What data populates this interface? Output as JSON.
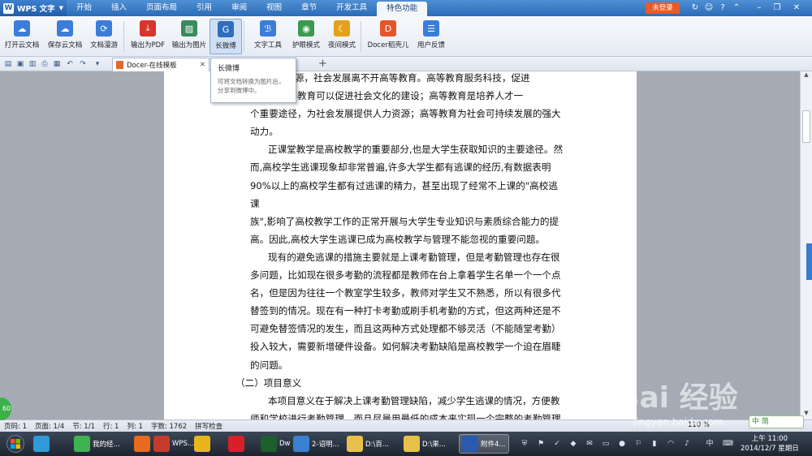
{
  "app": {
    "name": "WPS 文字"
  },
  "menu": {
    "tabs": [
      "开始",
      "插入",
      "页面布局",
      "引用",
      "审阅",
      "视图",
      "章节",
      "开发工具",
      "特色功能"
    ],
    "active_index": 8,
    "login_label": "未登录"
  },
  "ribbon": {
    "buttons": [
      {
        "label": "打开云文档",
        "icon": "cloud-open-icon",
        "color": "#3b7dd8"
      },
      {
        "label": "保存云文档",
        "icon": "cloud-save-icon",
        "color": "#3b7dd8"
      },
      {
        "label": "文档漫游",
        "icon": "roaming-icon",
        "color": "#3b7dd8"
      },
      {
        "label": "输出为PDF",
        "icon": "pdf-icon",
        "color": "#d9342b"
      },
      {
        "label": "输出为图片",
        "icon": "image-icon",
        "color": "#3a8a5c"
      },
      {
        "label": "长微博",
        "icon": "weibo-icon",
        "color": "#2f6dbf"
      },
      {
        "label": "文字工具",
        "icon": "text-tool-icon",
        "color": "#3b7dd8"
      },
      {
        "label": "护眼模式",
        "icon": "eye-icon",
        "color": "#3b9a4e"
      },
      {
        "label": "夜间模式",
        "icon": "moon-icon",
        "color": "#e4a21a"
      },
      {
        "label": "Docer稻壳儿",
        "icon": "docer-icon",
        "color": "#e8542a"
      },
      {
        "label": "用户反馈",
        "icon": "feedback-icon",
        "color": "#3b7dd8"
      }
    ]
  },
  "doc_tab": {
    "title": "Docer-在线模板"
  },
  "tooltip": {
    "title": "长微博",
    "description": "可将文档转换为图片后，分享到微博中。"
  },
  "document": {
    "lines": [
      "动力之源，社会发展离不开高等教育。高等教育服务科技，促进",
      "发展；高等教育可以促进社会文化的建设；高等教育是培养人才一",
      "个重要途径，为社会发展提供人力资源；高等教育为社会可持续发展的强大",
      "动力。",
      "正课堂教学是高校教学的重要部分,也是大学生获取知识的主要途径。然",
      "而,高校学生逃课现象却非常普遍,许多大学生都有逃课的经历,有数据表明",
      "90%以上的高校学生都有过逃课的精力，甚至出现了经常不上课的\"高校逃课",
      "族\",影响了高校教学工作的正常开展与大学生专业知识与素质综合能力的提",
      "高。因此,高校大学生逃课已成为高校教学与管理不能忽视的重要问题。",
      "现有的避免逃课的措施主要就是上课考勤管理，但是考勤管理也存在很",
      "多问题，比如现在很多考勤的流程都是教师在台上拿着学生名单一个一个点",
      "名，但是因为往往一个教室学生较多，教师对学生又不熟悉，所以有很多代",
      "替签到的情况。现在有一种打卡考勤或刷手机考勤的方式，但这两种还是不",
      "可避免替签情况的发生，而且这两种方式处理都不够灵活（不能随堂考勤）",
      "投入较大，需要新增硬件设备。如何解决考勤缺陷是高校教学一个迫在眉睫",
      "的问题。",
      "（二）项目意义",
      "本项目意义在于解决上课考勤管理缺陷，减少学生逃课的情况，方便教",
      "师和学校进行考勤管理，而且尽量用最低的成本来实现一个完整的考勤管理"
    ]
  },
  "status": {
    "page": "页码: 1",
    "pages": "页面: 1/4",
    "section": "节: 1/1",
    "row": "行: 1",
    "col": "列: 1",
    "words": "字数: 1762",
    "spell": "拼写检查",
    "zoom": "110 %"
  },
  "taskbar": {
    "items": [
      {
        "label": "",
        "icon": "game-icon",
        "color": "#2f9ad6"
      },
      {
        "label": "我的经...",
        "icon": "baidu-exp-icon",
        "color": "#3fb34f"
      },
      {
        "label": "",
        "icon": "firefox-icon",
        "color": "#e66a1f"
      },
      {
        "label": "WPS...",
        "icon": "wps-icon",
        "color": "#c43b2c"
      },
      {
        "label": "",
        "icon": "chrome-icon",
        "color": "#e8b61c"
      },
      {
        "label": "",
        "icon": "opera-icon",
        "color": "#d8202a"
      },
      {
        "label": "Dw",
        "icon": "dreamweaver-icon",
        "color": "#1d5e2c"
      },
      {
        "label": "2-诏明...",
        "icon": "qq-icon",
        "color": "#3a7fd0"
      },
      {
        "label": "D:\\百...",
        "icon": "folder-icon",
        "color": "#e8c14a"
      },
      {
        "label": "D:\\果...",
        "icon": "folder-icon",
        "color": "#e8c14a"
      },
      {
        "label": "附件4...",
        "icon": "word-icon",
        "color": "#2a5ab0"
      }
    ],
    "clock_time": "上午 11:00",
    "clock_date": "2014/12/7 星期日",
    "ime": "中"
  },
  "overlays": {
    "badge": "60",
    "watermark": "Bai 经验",
    "watermark_url": "jingyan.baidu.com",
    "im_label": "中 简"
  }
}
